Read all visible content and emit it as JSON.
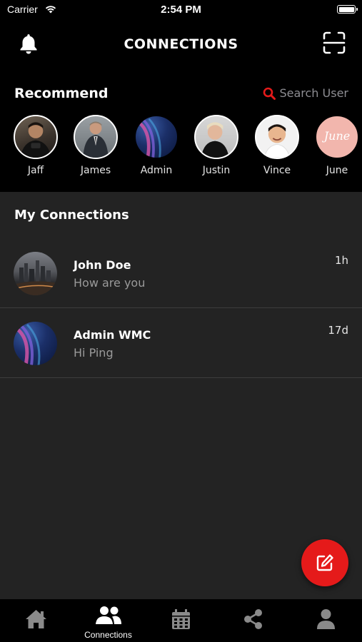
{
  "status_bar": {
    "carrier": "Carrier",
    "time": "2:54 PM"
  },
  "header": {
    "title": "CONNECTIONS",
    "left_icon": "bell-icon",
    "right_icon": "scan-icon"
  },
  "recommend": {
    "heading": "Recommend",
    "search_label": "Search User",
    "users": [
      {
        "name": "Jaff"
      },
      {
        "name": "James"
      },
      {
        "name": "Admin"
      },
      {
        "name": "Justin"
      },
      {
        "name": "Vince"
      },
      {
        "name": "June",
        "photo_text": "June"
      }
    ]
  },
  "my_connections": {
    "heading": "My Connections",
    "items": [
      {
        "name": "John Doe",
        "message": "How are you",
        "time": "1h"
      },
      {
        "name": "Admin WMC",
        "message": "Hi Ping",
        "time": "17d"
      }
    ]
  },
  "tabs": [
    {
      "icon": "home-icon",
      "label": ""
    },
    {
      "icon": "connections-icon",
      "label": "Connections"
    },
    {
      "icon": "calendar-icon",
      "label": ""
    },
    {
      "icon": "share-icon",
      "label": ""
    },
    {
      "icon": "profile-icon",
      "label": ""
    }
  ],
  "colors": {
    "accent": "#e51a1a",
    "background": "#000000",
    "panel": "#232323"
  }
}
